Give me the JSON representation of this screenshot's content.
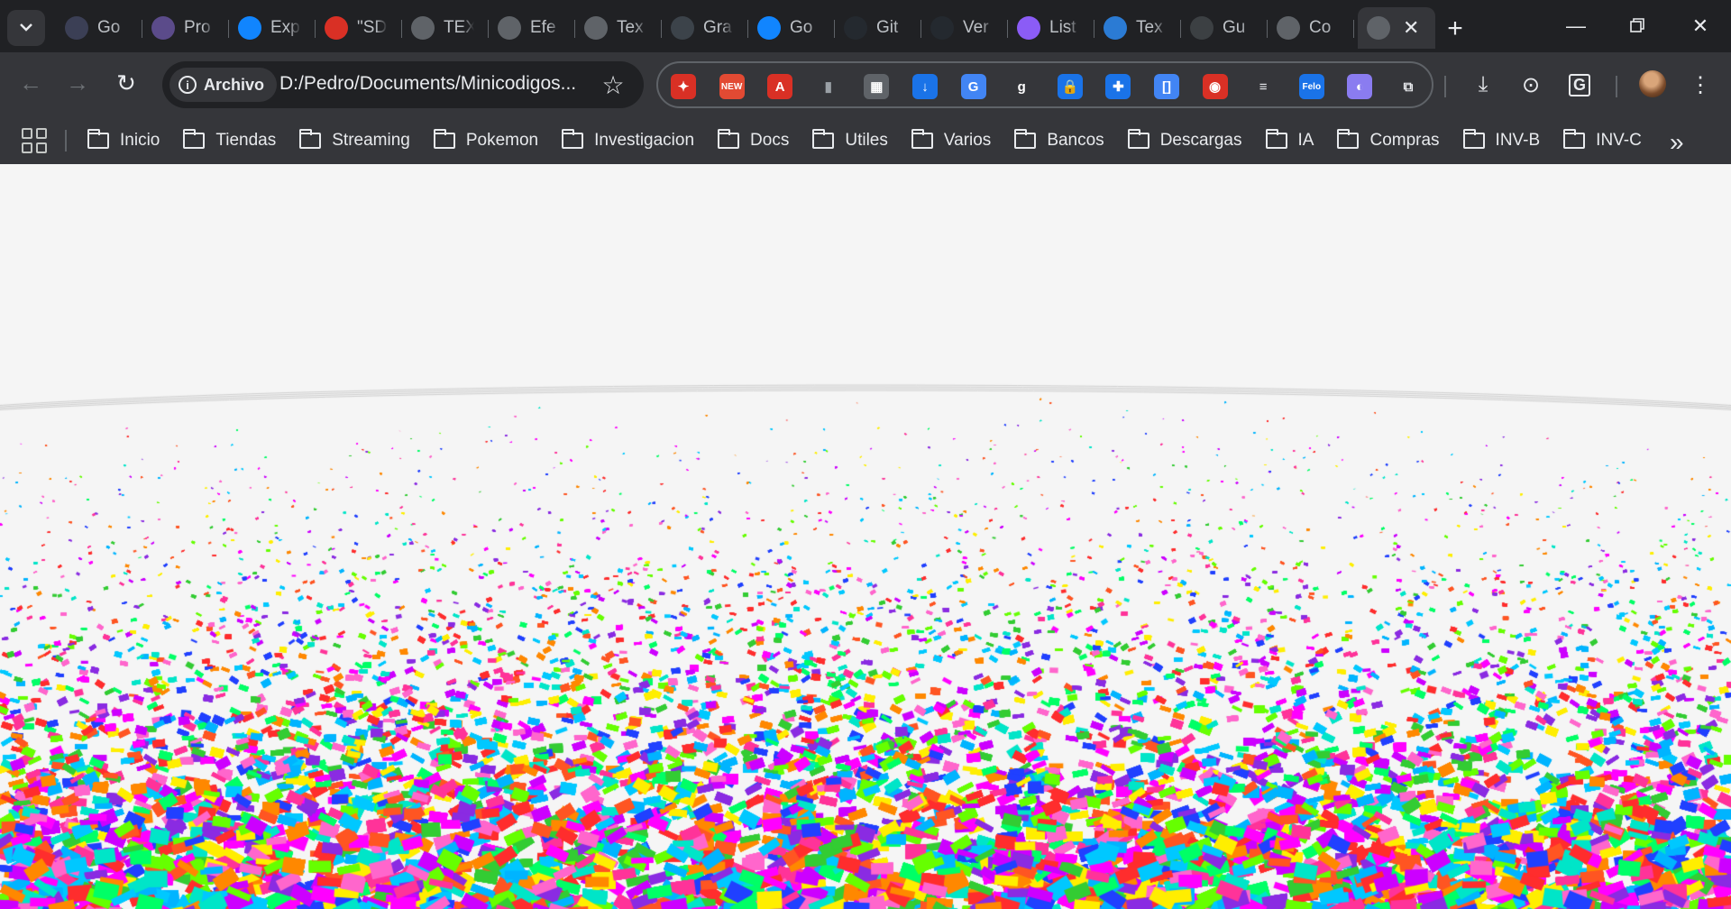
{
  "tabs": [
    {
      "title": "Go",
      "icon": "gemini-icon",
      "color": "#3b3f55"
    },
    {
      "title": "Pro",
      "icon": "colorful-circle-icon",
      "color": "#5b4b8a"
    },
    {
      "title": "Exp",
      "icon": "butterfly-icon",
      "color": "#1185fe"
    },
    {
      "title": "\"SD",
      "icon": "calendar-50-icon",
      "color": "#d93025"
    },
    {
      "title": "TEX",
      "icon": "globe-icon",
      "color": "#5f6368"
    },
    {
      "title": "Efe",
      "icon": "globe-icon",
      "color": "#5f6368"
    },
    {
      "title": "Tex",
      "icon": "globe-icon",
      "color": "#5f6368"
    },
    {
      "title": "Gra",
      "icon": "wordpress-icon",
      "color": "#3c434a"
    },
    {
      "title": "Go",
      "icon": "butterfly-icon",
      "color": "#1185fe"
    },
    {
      "title": "Git",
      "icon": "github-icon",
      "color": "#24292f"
    },
    {
      "title": "Ver",
      "icon": "github-icon",
      "color": "#24292f"
    },
    {
      "title": "List",
      "icon": "vite-icon",
      "color": "#8b5cf6"
    },
    {
      "title": "Tex",
      "icon": "tt-icon",
      "color": "#2b7bd4"
    },
    {
      "title": "Gu",
      "icon": "swirl-icon",
      "color": "#3c4043"
    },
    {
      "title": "Co",
      "icon": "globe-icon",
      "color": "#5f6368"
    }
  ],
  "active_tab": {
    "icon": "globe-icon"
  },
  "omnibox": {
    "chip": "Archivo",
    "url": "D:/Pedro/Documents/Minicodigos..."
  },
  "extensions": [
    {
      "name": "magic-wand-extension-icon",
      "color": "#d93025",
      "glyph": "✦"
    },
    {
      "name": "new-folder-extension-icon",
      "color": "#e24a33",
      "glyph": "NEW"
    },
    {
      "name": "a-circle-extension-icon",
      "color": "#d93025",
      "glyph": "A"
    },
    {
      "name": "bottle-extension-icon",
      "color": "#9aa0a6",
      "glyph": "▮"
    },
    {
      "name": "image-extension-icon",
      "color": "#5f6368",
      "glyph": "▦"
    },
    {
      "name": "download-extension-icon",
      "color": "#1a73e8",
      "glyph": "↓"
    },
    {
      "name": "translate-extension-icon",
      "color": "#4285f4",
      "glyph": "G"
    },
    {
      "name": "grammarly-extension-icon",
      "color": "#ffffff",
      "glyph": "g"
    },
    {
      "name": "lock-extension-icon",
      "color": "#1a73e8",
      "glyph": "🔒"
    },
    {
      "name": "plus-extension-icon",
      "color": "#1a73e8",
      "glyph": "✚"
    },
    {
      "name": "bracket-extension-icon",
      "color": "#4285f4",
      "glyph": "[]"
    },
    {
      "name": "record-extension-icon",
      "color": "#d93025",
      "glyph": "◉"
    },
    {
      "name": "bars-extension-icon",
      "color": "#e8eaed",
      "glyph": "≡"
    },
    {
      "name": "felo-extension-icon",
      "color": "#1a73e8",
      "glyph": "Felo"
    },
    {
      "name": "purple-extension-icon",
      "color": "#8a7cf0",
      "glyph": "◐"
    },
    {
      "name": "puzzle-extension-icon",
      "color": "#e8eaed",
      "glyph": "⧉"
    }
  ],
  "bookmarks": [
    "Inicio",
    "Tiendas",
    "Streaming",
    "Pokemon",
    "Investigacion",
    "Docs",
    "Utiles",
    "Varios",
    "Bancos",
    "Descargas",
    "IA",
    "Compras",
    "INV-B",
    "INV-C"
  ],
  "scene": {
    "background": "#f5f5f5",
    "grid_color": "#cfcfcf",
    "palette": [
      "#ff2d2d",
      "#ff00ff",
      "#00ff66",
      "#00c8ff",
      "#2040ff",
      "#ffee00",
      "#ff8800",
      "#8a2be2",
      "#00e5c8",
      "#ff3399",
      "#66ff00",
      "#00b4ff",
      "#ff5522",
      "#cc00ff",
      "#33cc33",
      "#ff66cc"
    ]
  }
}
